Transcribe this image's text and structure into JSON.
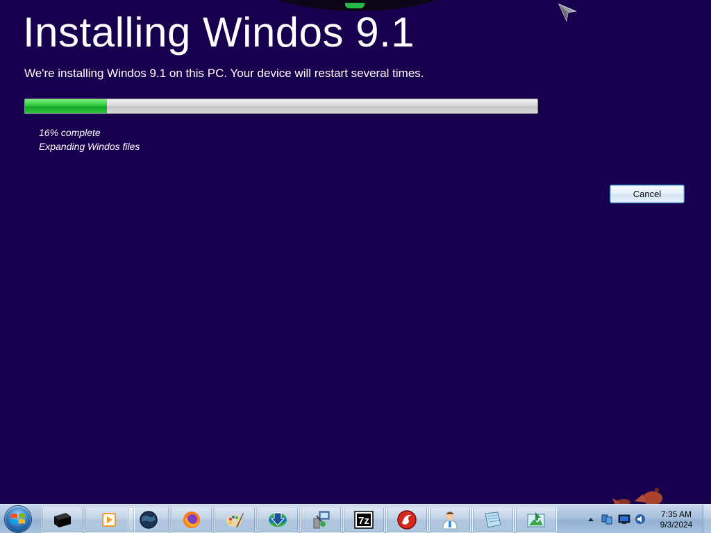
{
  "setup": {
    "title": "Installing Windos 9.1",
    "subtitle": "We're installing Windos 9.1 on this PC. Your device will restart several times.",
    "progress_percent": 16,
    "status_percent_text": "16% complete",
    "status_task_text": "Expanding Windos files",
    "cancel_label": "Cancel"
  },
  "colors": {
    "background": "#18004f",
    "progress_fill": "#2fcb3c",
    "progress_track": "#d6d6d6"
  },
  "taskbar": {
    "start_icon": "windows-orb-icon",
    "pinned": [
      "black-box-icon",
      "media-player-icon",
      "globe-icon",
      "firefox-icon",
      "paint-icon",
      "download-manager-icon",
      "network-setup-icon",
      "7zip-icon",
      "red-app-icon",
      "user-assistant-icon",
      "notepad-icon",
      "image-viewer-icon"
    ],
    "tray_icons": [
      "show-hidden-icons-arrow",
      "network-icon",
      "monitor-icon",
      "volume-icon"
    ],
    "clock": {
      "time": "7:35 AM",
      "date": "9/3/2024"
    }
  }
}
